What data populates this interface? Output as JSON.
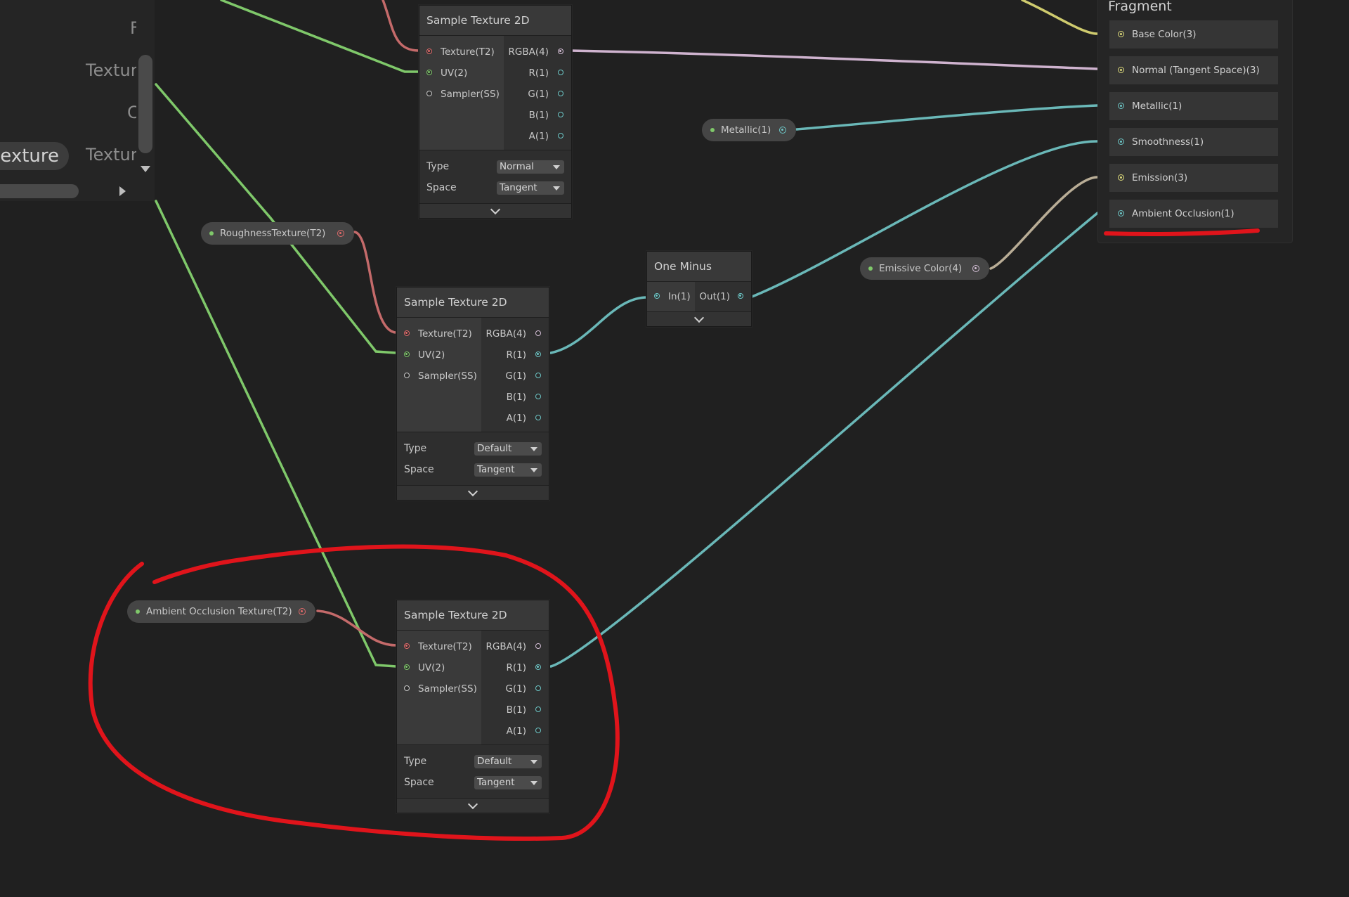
{
  "blackboard": {
    "row1_text": "F",
    "row2_text": "Textur",
    "row3_text": "C",
    "selected_pill": "exture",
    "row4_text": "Textur"
  },
  "colors": {
    "texture_port": "#e06a6a",
    "uv_port": "#7fc86a",
    "vector4_port": "#d4bfd6",
    "float_port": "#6ec8c8",
    "vector3_port": "#dcd97a",
    "sampler_port": "#c8c8c8",
    "annotation": "#e0141b"
  },
  "nodes": {
    "sample_normal": {
      "title": "Sample Texture 2D",
      "inputs": [
        "Texture(T2)",
        "UV(2)",
        "Sampler(SS)"
      ],
      "outputs": [
        "RGBA(4)",
        "R(1)",
        "G(1)",
        "B(1)",
        "A(1)"
      ],
      "type_label": "Type",
      "type_value": "Normal",
      "space_label": "Space",
      "space_value": "Tangent"
    },
    "sample_roughness": {
      "title": "Sample Texture 2D",
      "inputs": [
        "Texture(T2)",
        "UV(2)",
        "Sampler(SS)"
      ],
      "outputs": [
        "RGBA(4)",
        "R(1)",
        "G(1)",
        "B(1)",
        "A(1)"
      ],
      "type_label": "Type",
      "type_value": "Default",
      "space_label": "Space",
      "space_value": "Tangent"
    },
    "sample_ao": {
      "title": "Sample Texture 2D",
      "inputs": [
        "Texture(T2)",
        "UV(2)",
        "Sampler(SS)"
      ],
      "outputs": [
        "RGBA(4)",
        "R(1)",
        "G(1)",
        "B(1)",
        "A(1)"
      ],
      "type_label": "Type",
      "type_value": "Default",
      "space_label": "Space",
      "space_value": "Tangent"
    },
    "one_minus": {
      "title": "One Minus",
      "input": "In(1)",
      "output": "Out(1)"
    }
  },
  "properties": {
    "roughness_texture": "RoughnessTexture(T2)",
    "metallic": "Metallic(1)",
    "emissive_color": "Emissive Color(4)",
    "ao_texture": "Ambient Occlusion Texture(T2)"
  },
  "fragment": {
    "title": "Fragment",
    "slots": [
      "Base Color(3)",
      "Normal (Tangent Space)(3)",
      "Metallic(1)",
      "Smoothness(1)",
      "Emission(3)",
      "Ambient Occlusion(1)"
    ]
  }
}
